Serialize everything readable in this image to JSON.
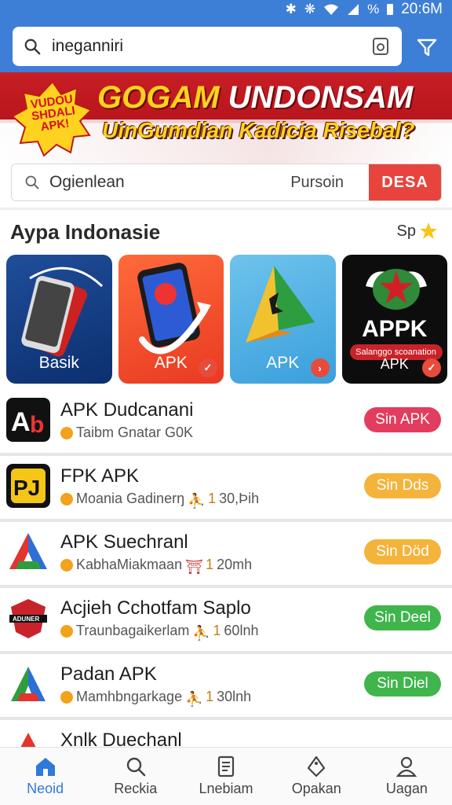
{
  "status_bar": {
    "battery": "%",
    "time": "20:6M"
  },
  "search": {
    "query": "ineganniri"
  },
  "banner": {
    "badge": "VUDOU SHDALI APK!",
    "title_highlight": "GOGAM",
    "title_rest": " UNDONSAM",
    "subtitle": "UinGumdian Kadicia Risebal?"
  },
  "sub_search": {
    "placeholder": "Ogienlean",
    "label": "Pursoin",
    "button": "DESA"
  },
  "section": {
    "title": "Aypa Indonasie",
    "more": "Sp"
  },
  "featured": [
    {
      "label": "Basik"
    },
    {
      "label": "APK"
    },
    {
      "label": "APK"
    },
    {
      "label": "APK",
      "big": "APPK",
      "tag": "Salanggo scoanation"
    }
  ],
  "apps": [
    {
      "name": "APK Dudcanani",
      "meta": "Taibm Gnatar G0K",
      "num": "",
      "size": "",
      "action": "Sin APK",
      "color": "#e23d5e"
    },
    {
      "name": "FPK APK",
      "meta": "Moania Gadinerŋ",
      "num": "1",
      "size": "30,Þih",
      "action": "Sin Dds",
      "color": "#f4b33a"
    },
    {
      "name": "APK Suechranl",
      "meta": "KabhaMiakmaan",
      "num": "1",
      "size": "20mh",
      "action": "Sin Död",
      "color": "#f4b33a"
    },
    {
      "name": "Acjieh Cchotfam Saplo",
      "meta": "Traunbagaikerlam",
      "num": "1",
      "size": "60lnh",
      "action": "Sin Deel",
      "color": "#3fb54c"
    },
    {
      "name": "Padan APK",
      "meta": "Mamhbngarkage",
      "num": "1",
      "size": "30lnh",
      "action": "Sin Diel",
      "color": "#3fb54c"
    },
    {
      "name": "Xnlk Duechanl",
      "meta": "",
      "num": "",
      "size": "",
      "action": "",
      "color": "#3fb54c"
    }
  ],
  "bottom_nav": [
    {
      "label": "Neoid",
      "icon": "home-icon",
      "active": true
    },
    {
      "label": "Reckia",
      "icon": "search-icon",
      "active": false
    },
    {
      "label": "Lnebiam",
      "icon": "document-icon",
      "active": false
    },
    {
      "label": "Opakan",
      "icon": "tag-icon",
      "active": false
    },
    {
      "label": "Uagan",
      "icon": "user-icon",
      "active": false
    }
  ],
  "colors": {
    "header": "#3d7fd6",
    "banner_red": "#c81e25",
    "accent_yellow": "#ffd21f",
    "active_nav": "#2e7ad9"
  }
}
